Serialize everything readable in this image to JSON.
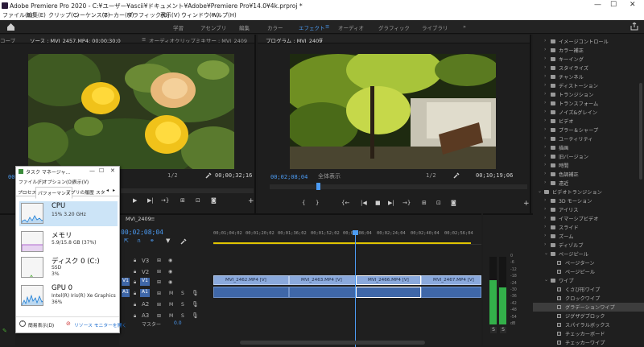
{
  "window": {
    "title": "Adobe Premiere Pro 2020 - C:¥ユーザー¥ascii¥ドキュメント¥Adobe¥Premiere Pro¥14.0¥4k.prproj *",
    "minimize": "—",
    "maximize": "☐",
    "close": "✕"
  },
  "menu": [
    "ファイル(F)",
    "編集(E)",
    "クリップ(C)",
    "シーケンス(S)",
    "マーカー(M)",
    "グラフィック(G)",
    "表示(V)",
    "ウィンドウ(W)",
    "ヘルプ(H)"
  ],
  "workspaces": {
    "items": [
      "学習",
      "アセンブリ",
      "編集",
      "カラー",
      "エフェクト",
      "オーディオ",
      "グラフィック",
      "ライブラリ"
    ],
    "active": "エフェクト",
    "menu_icon": "≡",
    "more": "»"
  },
  "source": {
    "left_label": "コープ",
    "tab": "ソース : MVI_2457.MP4: 00;00;30;0",
    "tab_menu": "≡",
    "mixer_tab": "オーディオクリップミキサー : MVI_2409",
    "timecode_left": "00;00;00;00",
    "fit": "1/2",
    "timecode_right": "00;00;32;16"
  },
  "program": {
    "tab": "プログラム : MVI_2409",
    "tab_menu": "≡",
    "timecode_left": "00;02;08;04",
    "fit": "全体表示",
    "zoom": "1/2",
    "timecode_right": "00;10;19;06"
  },
  "effects": {
    "items": [
      {
        "label": "イメージコントロール",
        "type": "folder",
        "level": 1
      },
      {
        "label": "カラー補正",
        "type": "folder",
        "level": 1
      },
      {
        "label": "キーイング",
        "type": "folder",
        "level": 1
      },
      {
        "label": "スタイライズ",
        "type": "folder",
        "level": 1
      },
      {
        "label": "チャンネル",
        "type": "folder",
        "level": 1
      },
      {
        "label": "ディストーション",
        "type": "folder",
        "level": 1
      },
      {
        "label": "トランジション",
        "type": "folder",
        "level": 1
      },
      {
        "label": "トランスフォーム",
        "type": "folder",
        "level": 1
      },
      {
        "label": "ノイズ&グレイン",
        "type": "folder",
        "level": 1
      },
      {
        "label": "ビデオ",
        "type": "folder",
        "level": 1
      },
      {
        "label": "ブラー＆シャープ",
        "type": "folder",
        "level": 1
      },
      {
        "label": "ユーティリティ",
        "type": "folder",
        "level": 1
      },
      {
        "label": "描画",
        "type": "folder",
        "level": 1
      },
      {
        "label": "旧バージョン",
        "type": "folder",
        "level": 1
      },
      {
        "label": "時間",
        "type": "folder",
        "level": 1
      },
      {
        "label": "色調補正",
        "type": "folder",
        "level": 1
      },
      {
        "label": "遠近",
        "type": "folder",
        "level": 1
      },
      {
        "label": "ビデオトランジション",
        "type": "folder",
        "level": 0,
        "open": true
      },
      {
        "label": "3D モーション",
        "type": "folder",
        "level": 1
      },
      {
        "label": "アイリス",
        "type": "folder",
        "level": 1
      },
      {
        "label": "イマーシブビデオ",
        "type": "folder",
        "level": 1
      },
      {
        "label": "スライド",
        "type": "folder",
        "level": 1
      },
      {
        "label": "ズーム",
        "type": "folder",
        "level": 1
      },
      {
        "label": "ディゾルブ",
        "type": "folder",
        "level": 1
      },
      {
        "label": "ページピール",
        "type": "folder",
        "level": 1,
        "open": true
      },
      {
        "label": "ページターン",
        "type": "item",
        "level": 2
      },
      {
        "label": "ページピール",
        "type": "item",
        "level": 2
      },
      {
        "label": "ワイプ",
        "type": "folder",
        "level": 1,
        "open": true
      },
      {
        "label": "くさび形ワイプ",
        "type": "item",
        "level": 2
      },
      {
        "label": "クロックワイプ",
        "type": "item",
        "level": 2
      },
      {
        "label": "グラデーションワイプ",
        "type": "item",
        "level": 2,
        "selected": true
      },
      {
        "label": "ジグザグブロック",
        "type": "item",
        "level": 2
      },
      {
        "label": "スパイラルボックス",
        "type": "item",
        "level": 2
      },
      {
        "label": "チェッカーボード",
        "type": "item",
        "level": 2
      },
      {
        "label": "チェッカーワイプ",
        "type": "item",
        "level": 2
      }
    ]
  },
  "timeline": {
    "tab": "MVI_2409",
    "tab_menu": "≡",
    "timecode": "00;02;08;04",
    "ruler": [
      "00;01;04;02",
      "00;01;20;02",
      "00;01;36;02",
      "00;01;52;02",
      "00;02;08;04",
      "00;02;24;04",
      "00;02;40;04",
      "00;02;56;04"
    ],
    "tracks": [
      {
        "name": "V3",
        "kind": "video"
      },
      {
        "name": "V2",
        "kind": "video"
      },
      {
        "name": "V1",
        "kind": "video",
        "src": "V1"
      },
      {
        "name": "A1",
        "kind": "audio",
        "src": "A1"
      },
      {
        "name": "A2",
        "kind": "audio"
      },
      {
        "name": "A3",
        "kind": "audio"
      }
    ],
    "master": "マスター",
    "master_value": "0.0",
    "clips": [
      "MVI_2462.MP4 [V]",
      "MVI_2463.MP4 [V]",
      "MVI_2466.MP4 [V]",
      "MVI_2467.MP4 [V]"
    ],
    "mute": "M",
    "solo": "S"
  },
  "meter": {
    "scale": [
      "0",
      "-6",
      "-12",
      "-18",
      "-24",
      "-30",
      "-36",
      "-42",
      "-48",
      "-54",
      "dB"
    ],
    "labels": [
      "S",
      "S"
    ],
    "levels": [
      0.65,
      0.55
    ]
  },
  "taskmanager": {
    "title": "タスク マネージャ...",
    "minimize": "—",
    "maximize": "☐",
    "close": "✕",
    "menu": [
      "ファイル(F)",
      "オプション(O)",
      "表示(V)"
    ],
    "tabs": [
      "プロセス",
      "パフォーマンス",
      "アプリの履歴",
      "スタ"
    ],
    "active_tab": "パフォーマンス",
    "items": [
      {
        "name": "CPU",
        "line1": "15%  3.20 GHz",
        "line2": "",
        "color": "#1f7fd6",
        "selected": true
      },
      {
        "name": "メモリ",
        "line1": "5.9/15.8 GB (37%)",
        "line2": "",
        "color": "#9b3fc4"
      },
      {
        "name": "ディスク 0 (C:)",
        "line1": "SSD",
        "line2": "3%",
        "color": "#4aa832"
      },
      {
        "name": "GPU 0",
        "line1": "Intel(R) Iris(R) Xe Graphics",
        "line2": "36%",
        "color": "#1f7fd6"
      }
    ],
    "less": "簡易表示(D)",
    "monitor": "リソース モニターを開く"
  }
}
